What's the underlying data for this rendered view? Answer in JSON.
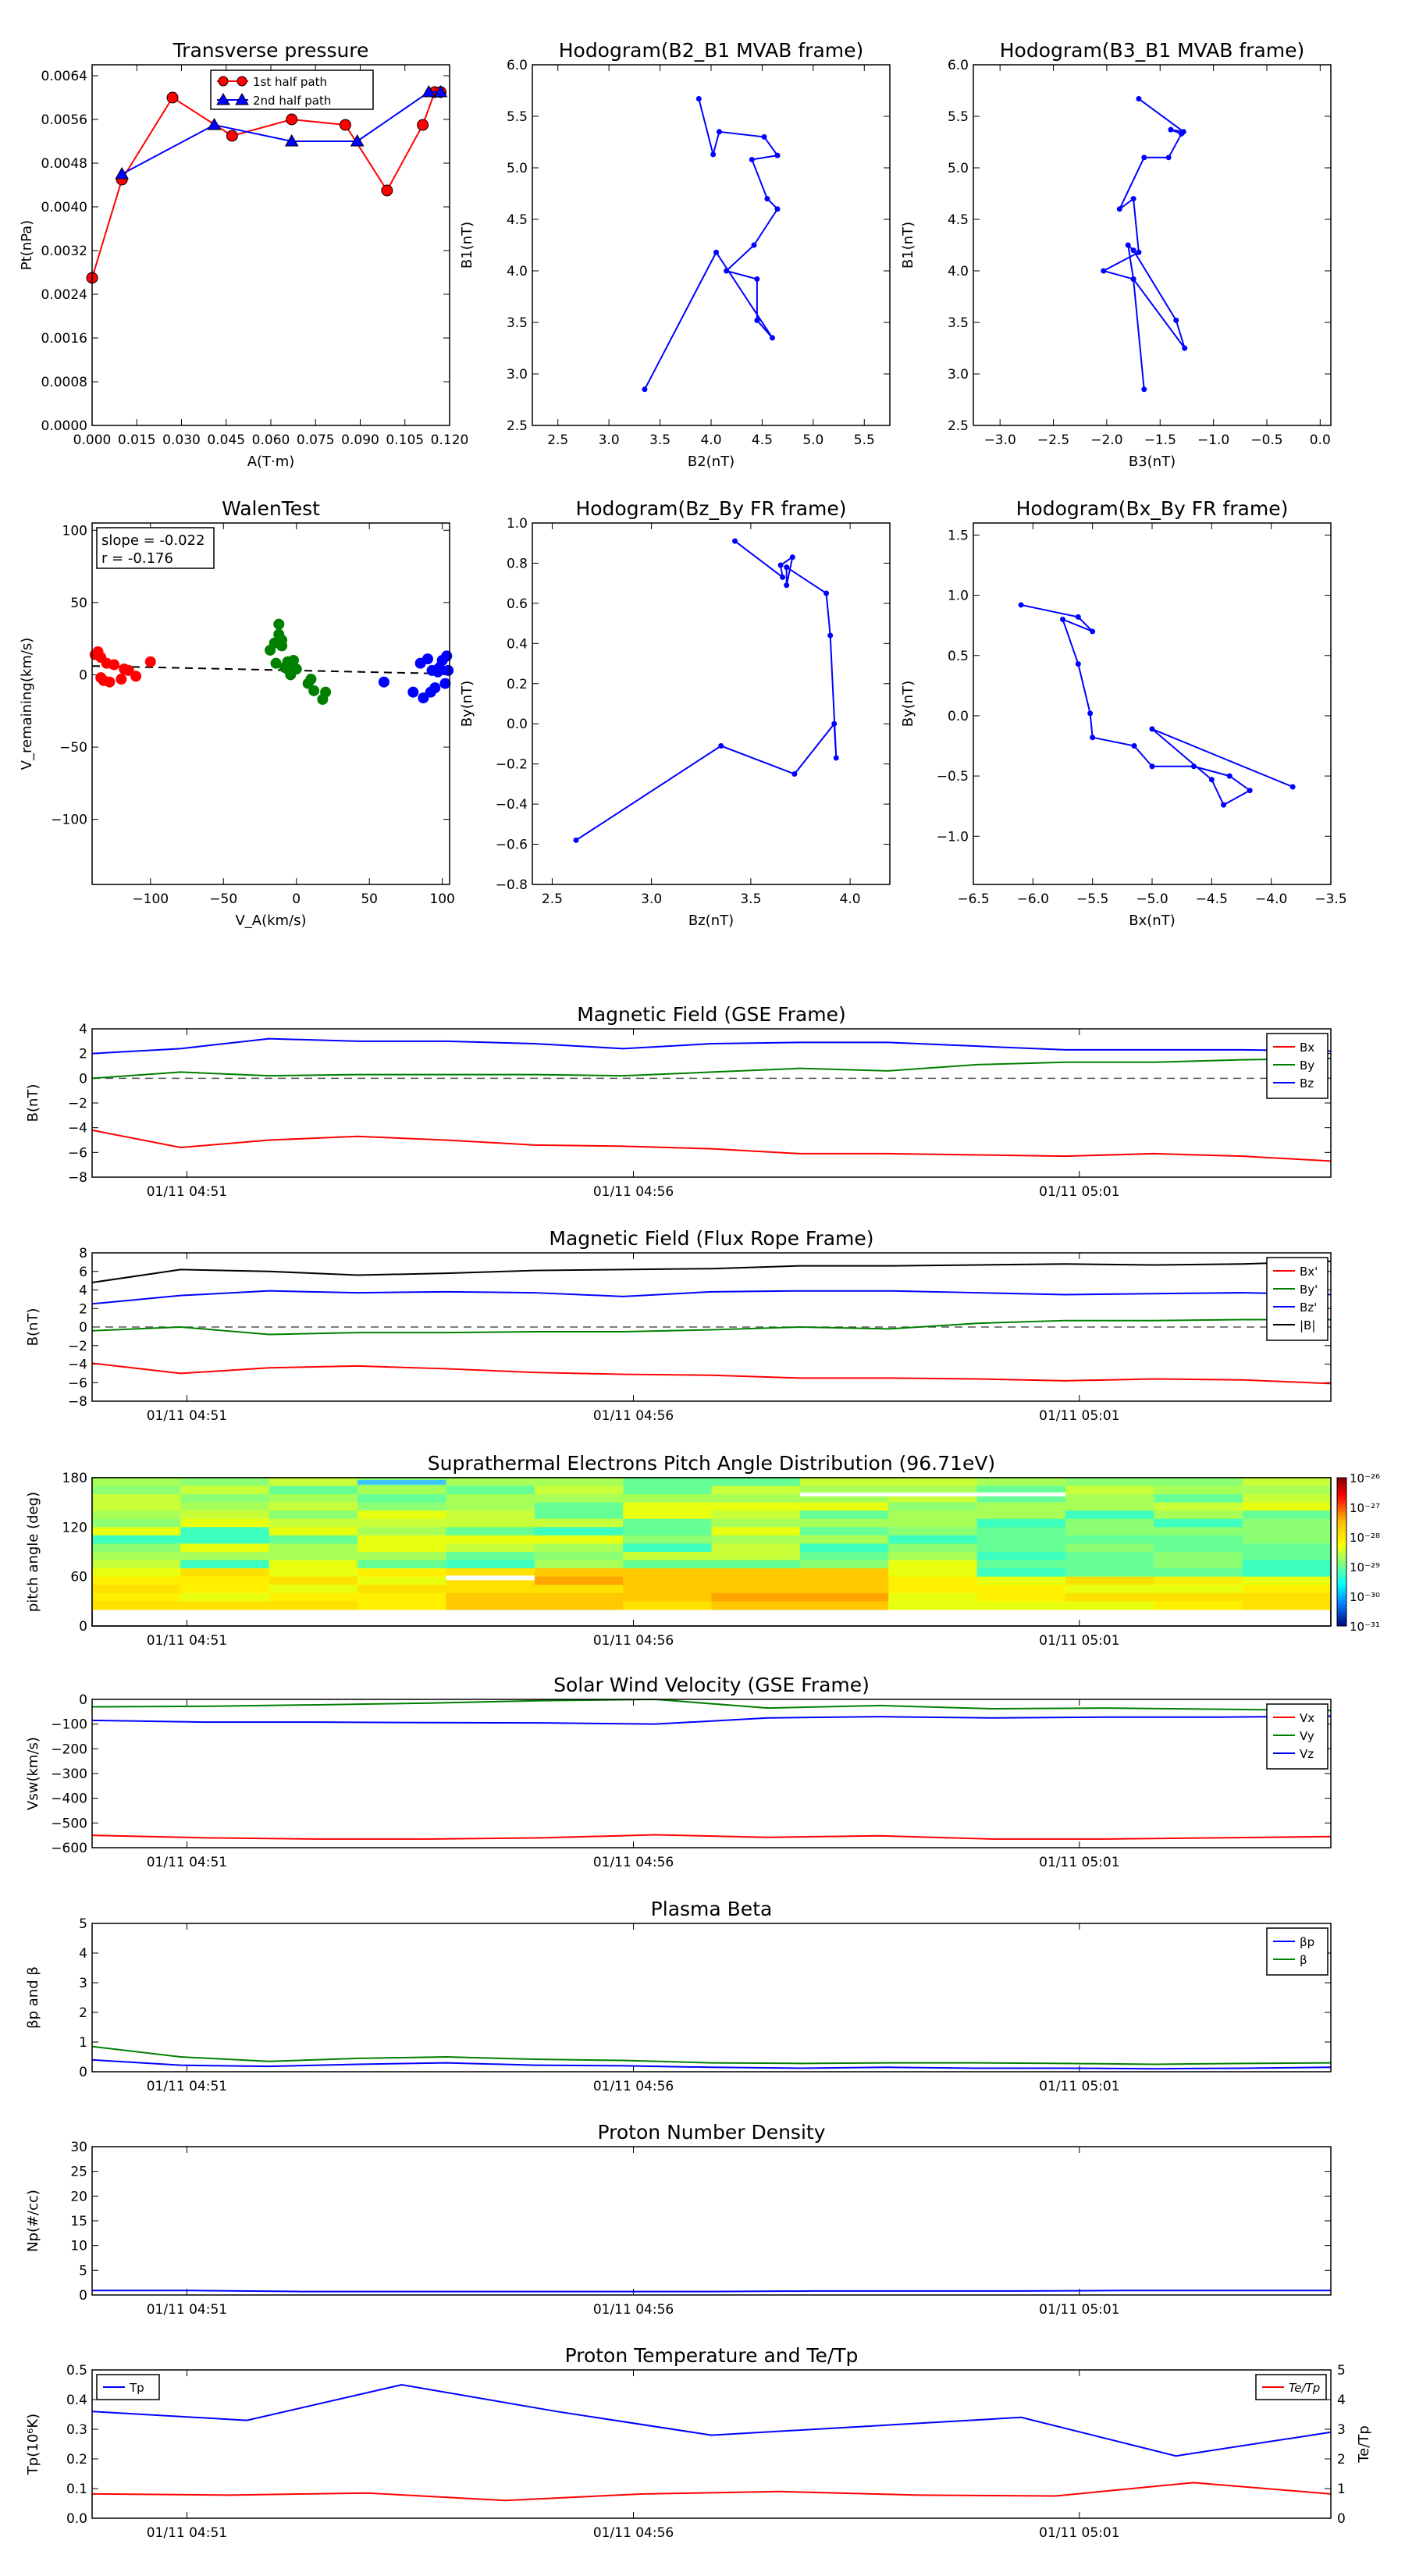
{
  "colors": {
    "red": "#ff0000",
    "green": "#008000",
    "blue": "#0000ff",
    "black": "#000000",
    "grey": "#555555"
  },
  "chart_data": [
    {
      "id": "transverse_pressure",
      "type": "line",
      "title": "Transverse pressure",
      "xlabel": "A(T·m)",
      "ylabel": "Pt(nPa)",
      "xlim": [
        0,
        0.12
      ],
      "ylim": [
        0,
        0.0066
      ],
      "xticks": [
        "0.000",
        "0.015",
        "0.030",
        "0.045",
        "0.060",
        "0.075",
        "0.090",
        "0.105",
        "0.120"
      ],
      "yticks": [
        "0.0000",
        "0.0008",
        "0.0016",
        "0.0024",
        "0.0032",
        "0.0040",
        "0.0048",
        "0.0056",
        "0.0064"
      ],
      "legend_position": "top-center",
      "series": [
        {
          "name": "1st half path",
          "color": "#ff0000",
          "marker": "circle",
          "x": [
            0.0,
            0.01,
            0.027,
            0.047,
            0.067,
            0.085,
            0.099,
            0.111,
            0.115,
            0.117
          ],
          "y": [
            0.0027,
            0.0045,
            0.006,
            0.0053,
            0.0056,
            0.0055,
            0.0043,
            0.0055,
            0.0061,
            0.0061
          ]
        },
        {
          "name": "2nd half path",
          "color": "#0000ff",
          "marker": "triangle",
          "x": [
            0.01,
            0.041,
            0.067,
            0.089,
            0.113,
            0.117
          ],
          "y": [
            0.0046,
            0.0055,
            0.0052,
            0.0052,
            0.0061,
            0.0061
          ]
        }
      ]
    },
    {
      "id": "hodogram_b2_b1",
      "type": "line",
      "title": "Hodogram(B2_B1 MVAB frame)",
      "xlabel": "B2(nT)",
      "ylabel": "B1(nT)",
      "xlim": [
        2.25,
        5.75
      ],
      "ylim": [
        2.5,
        6.0
      ],
      "xticks": [
        "2.5",
        "3.0",
        "3.5",
        "4.0",
        "4.5",
        "5.0",
        "5.5"
      ],
      "yticks": [
        "2.5",
        "3.0",
        "3.5",
        "4.0",
        "4.5",
        "5.0",
        "5.5",
        "6.0"
      ],
      "series": [
        {
          "color": "#0000ff",
          "marker": "dot",
          "x": [
            3.35,
            4.05,
            4.6,
            4.45,
            4.45,
            4.15,
            4.42,
            4.65,
            4.55,
            4.4,
            4.65,
            4.52,
            4.08,
            4.02,
            3.88
          ],
          "y": [
            2.85,
            4.18,
            3.35,
            3.52,
            3.92,
            4.0,
            4.25,
            4.6,
            4.7,
            5.08,
            5.12,
            5.3,
            5.35,
            5.13,
            5.67
          ]
        }
      ]
    },
    {
      "id": "hodogram_b3_b1",
      "type": "line",
      "title": "Hodogram(B3_B1 MVAB frame)",
      "xlabel": "B3(nT)",
      "ylabel": "B1(nT)",
      "xlim": [
        -3.25,
        0.1
      ],
      "ylim": [
        2.5,
        6.0
      ],
      "xticks": [
        "−3.0",
        "−2.5",
        "−2.0",
        "−1.5",
        "−1.0",
        "−0.5",
        "0.0"
      ],
      "yticks": [
        "2.5",
        "3.0",
        "3.5",
        "4.0",
        "4.5",
        "5.0",
        "5.5",
        "6.0"
      ],
      "series": [
        {
          "color": "#0000ff",
          "marker": "dot",
          "x": [
            -1.65,
            -1.75,
            -1.27,
            -1.35,
            -1.75,
            -1.8,
            -1.75,
            -2.03,
            -1.7,
            -1.75,
            -1.88,
            -1.65,
            -1.42,
            -1.3,
            -1.4,
            -1.28,
            -1.7
          ],
          "y": [
            2.85,
            3.92,
            3.25,
            3.52,
            4.2,
            4.25,
            3.92,
            4.0,
            4.18,
            4.7,
            4.6,
            5.1,
            5.1,
            5.33,
            5.37,
            5.35,
            5.67
          ]
        }
      ]
    },
    {
      "id": "walen_test",
      "type": "scatter",
      "title": "WalenTest",
      "xlabel": "V_A(km/s)",
      "ylabel": "V_remaining(km/s)",
      "xlim": [
        -140,
        105
      ],
      "ylim": [
        -145,
        105
      ],
      "xticks": [
        "−100",
        "−50",
        "0",
        "50",
        "100"
      ],
      "xtick_values": [
        -100,
        -50,
        0,
        50,
        100
      ],
      "yticks": [
        "−100",
        "−50",
        "0",
        "50",
        "100"
      ],
      "ytick_values": [
        -100,
        -50,
        0,
        50,
        100
      ],
      "annotation": {
        "slope": "slope = -0.022",
        "r": "r = -0.176"
      },
      "fit_line": {
        "slope": -0.022,
        "x": [
          -140,
          105
        ]
      },
      "series": [
        {
          "color": "#ff0000",
          "x": [
            -138,
            -136,
            -134,
            -134,
            -132,
            -130,
            -128,
            -125,
            -120,
            -118,
            -115,
            -110,
            -100
          ],
          "y": [
            14,
            16,
            12,
            -2,
            -4,
            8,
            -5,
            7,
            -3,
            4,
            3,
            -1,
            9
          ]
        },
        {
          "color": "#008000",
          "x": [
            -18,
            -15,
            -14,
            -12,
            -12,
            -10,
            -10,
            -8,
            -6,
            -5,
            -4,
            -2,
            0,
            8,
            10,
            12,
            18,
            20
          ],
          "y": [
            17,
            22,
            8,
            28,
            35,
            24,
            20,
            5,
            9,
            3,
            0,
            10,
            4,
            -6,
            -3,
            -11,
            -17,
            -12
          ]
        },
        {
          "color": "#0000ff",
          "x": [
            60,
            80,
            85,
            87,
            90,
            92,
            93,
            95,
            97,
            98,
            100,
            102,
            103,
            104
          ],
          "y": [
            -5,
            -12,
            8,
            -16,
            11,
            -12,
            3,
            -9,
            2,
            5,
            10,
            -6,
            13,
            3
          ]
        }
      ]
    },
    {
      "id": "hodogram_bz_by",
      "type": "line",
      "title": "Hodogram(Bz_By FR frame)",
      "xlabel": "Bz(nT)",
      "ylabel": "By(nT)",
      "xlim": [
        2.4,
        4.2
      ],
      "ylim": [
        -0.8,
        1.0
      ],
      "xticks": [
        "2.5",
        "3.0",
        "3.5",
        "4.0"
      ],
      "xtick_values": [
        2.5,
        3.0,
        3.5,
        4.0
      ],
      "yticks": [
        "−0.8",
        "−0.6",
        "−0.4",
        "−0.2",
        "0.0",
        "0.2",
        "0.4",
        "0.6",
        "0.8",
        "1.0"
      ],
      "series": [
        {
          "color": "#0000ff",
          "marker": "dot",
          "x": [
            2.62,
            3.35,
            3.72,
            3.92,
            3.93,
            3.9,
            3.88,
            3.68,
            3.68,
            3.71,
            3.65,
            3.66,
            3.42
          ],
          "y": [
            -0.58,
            -0.11,
            -0.25,
            0.0,
            -0.17,
            0.44,
            0.65,
            0.78,
            0.69,
            0.83,
            0.79,
            0.73,
            0.91
          ]
        }
      ]
    },
    {
      "id": "hodogram_bx_by",
      "type": "line",
      "title": "Hodogram(Bx_By FR frame)",
      "xlabel": "Bx(nT)",
      "ylabel": "By(nT)",
      "xlim": [
        -6.5,
        -3.5
      ],
      "ylim": [
        -1.4,
        1.6
      ],
      "xticks": [
        "−6.5",
        "−6.0",
        "−5.5",
        "−5.0",
        "−4.5",
        "−4.0",
        "−3.5"
      ],
      "yticks": [
        "−1.0",
        "−0.5",
        "0.0",
        "0.5",
        "1.0",
        "1.5"
      ],
      "ytick_values": [
        -1.0,
        -0.5,
        0.0,
        0.5,
        1.0,
        1.5
      ],
      "series": [
        {
          "color": "#0000ff",
          "marker": "dot",
          "x": [
            -6.1,
            -5.62,
            -5.5,
            -5.75,
            -5.62,
            -5.52,
            -5.5,
            -5.15,
            -5.0,
            -4.65,
            -4.35,
            -4.18,
            -4.4,
            -4.5,
            -5.0,
            -3.82
          ],
          "y": [
            0.92,
            0.82,
            0.7,
            0.8,
            0.43,
            0.02,
            -0.18,
            -0.25,
            -0.42,
            -0.42,
            -0.5,
            -0.62,
            -0.74,
            -0.53,
            -0.11,
            -0.59
          ]
        }
      ]
    },
    {
      "id": "mag_gse",
      "type": "line",
      "title": "Magnetic Field (GSE Frame)",
      "ylabel": "B(nT)",
      "ylim": [
        -8,
        4
      ],
      "yticks": [
        "−8",
        "−6",
        "−4",
        "−2",
        "0",
        "2",
        "4"
      ],
      "xticklabels": [
        "01/11 04:51",
        "01/11 04:56",
        "01/11 05:01"
      ],
      "legend_position": "top-right",
      "zero_line": true,
      "series": [
        {
          "name": "Bx",
          "color": "#ff0000",
          "y": [
            -4.2,
            -5.6,
            -5.0,
            -4.7,
            -5.0,
            -5.4,
            -5.5,
            -5.7,
            -6.1,
            -6.1,
            -6.2,
            -6.3,
            -6.1,
            -6.3,
            -6.7
          ]
        },
        {
          "name": "By",
          "color": "#008000",
          "y": [
            0.0,
            0.5,
            0.2,
            0.3,
            0.3,
            0.3,
            0.2,
            0.5,
            0.8,
            0.6,
            1.1,
            1.3,
            1.3,
            1.5,
            1.6
          ]
        },
        {
          "name": "Bz",
          "color": "#0000ff",
          "y": [
            2.0,
            2.4,
            3.2,
            3.0,
            3.0,
            2.8,
            2.4,
            2.8,
            2.9,
            2.9,
            2.6,
            2.3,
            2.3,
            2.3,
            2.2
          ]
        }
      ]
    },
    {
      "id": "mag_fr",
      "type": "line",
      "title": "Magnetic Field (Flux Rope Frame)",
      "ylabel": "B(nT)",
      "ylim": [
        -8,
        8
      ],
      "yticks": [
        "−8",
        "−6",
        "−4",
        "−2",
        "0",
        "2",
        "4",
        "6",
        "8"
      ],
      "xticklabels": [
        "01/11 04:51",
        "01/11 04:56",
        "01/11 05:01"
      ],
      "legend_position": "top-right",
      "zero_line": true,
      "series": [
        {
          "name": "Bx'",
          "color": "#ff0000",
          "y": [
            -3.9,
            -5.0,
            -4.4,
            -4.2,
            -4.5,
            -4.9,
            -5.1,
            -5.2,
            -5.5,
            -5.5,
            -5.6,
            -5.8,
            -5.6,
            -5.7,
            -6.1
          ]
        },
        {
          "name": "By'",
          "color": "#008000",
          "y": [
            -0.4,
            0.0,
            -0.8,
            -0.6,
            -0.6,
            -0.5,
            -0.5,
            -0.3,
            0.0,
            -0.2,
            0.4,
            0.7,
            0.7,
            0.8,
            0.8
          ]
        },
        {
          "name": "Bz'",
          "color": "#0000ff",
          "y": [
            2.5,
            3.4,
            3.9,
            3.7,
            3.8,
            3.7,
            3.3,
            3.8,
            3.9,
            3.9,
            3.7,
            3.5,
            3.6,
            3.7,
            3.5
          ]
        },
        {
          "name": "|B|",
          "color": "#000000",
          "y": [
            4.8,
            6.2,
            6.0,
            5.6,
            5.8,
            6.1,
            6.2,
            6.3,
            6.6,
            6.6,
            6.7,
            6.8,
            6.7,
            6.8,
            7.1
          ]
        }
      ]
    },
    {
      "id": "pitch_angle",
      "type": "heatmap",
      "title": "Suprathermal Electrons Pitch Angle Distribution (96.71eV)",
      "ylabel": "pitch angle (deg)",
      "ylim": [
        0,
        180
      ],
      "yticks": [
        "0",
        "60",
        "120",
        "180"
      ],
      "xticklabels": [
        "01/11 04:51",
        "01/11 04:56",
        "01/11 05:01"
      ],
      "colorbar_labels": [
        "10⁻²⁶",
        "10⁻²⁷",
        "10⁻²⁸",
        "10⁻²⁹",
        "10⁻³⁰",
        "10⁻³¹"
      ]
    },
    {
      "id": "vsw",
      "type": "line",
      "title": "Solar Wind Velocity (GSE Frame)",
      "ylabel": "Vsw(km/s)",
      "ylim": [
        -600,
        0
      ],
      "yticks": [
        "−600",
        "−500",
        "−400",
        "−300",
        "−200",
        "−100",
        "0"
      ],
      "xticklabels": [
        "01/11 04:51",
        "01/11 04:56",
        "01/11 05:01"
      ],
      "legend_position": "top-right",
      "series": [
        {
          "name": "Vx",
          "color": "#ff0000",
          "y": [
            -550,
            -560,
            -565,
            -565,
            -560,
            -548,
            -558,
            -552,
            -565,
            -565,
            -560,
            -555
          ]
        },
        {
          "name": "Vy",
          "color": "#008000",
          "y": [
            -30,
            -28,
            -22,
            -15,
            -5,
            0,
            -35,
            -25,
            -38,
            -35,
            -40,
            -45
          ]
        },
        {
          "name": "Vz",
          "color": "#0000ff",
          "y": [
            -85,
            -92,
            -92,
            -94,
            -95,
            -100,
            -75,
            -70,
            -75,
            -72,
            -72,
            -68
          ]
        }
      ]
    },
    {
      "id": "beta",
      "type": "line",
      "title": "Plasma Beta",
      "ylabel": "βp and β",
      "ylim": [
        0,
        5
      ],
      "yticks": [
        "0",
        "1",
        "2",
        "3",
        "4",
        "5"
      ],
      "xticklabels": [
        "01/11 04:51",
        "01/11 04:56",
        "01/11 05:01"
      ],
      "legend_position": "top-right",
      "series": [
        {
          "name": "βp",
          "color": "#0000ff",
          "y": [
            0.4,
            0.22,
            0.18,
            0.25,
            0.3,
            0.22,
            0.2,
            0.15,
            0.12,
            0.15,
            0.12,
            0.12,
            0.1,
            0.12,
            0.15
          ]
        },
        {
          "name": "β",
          "color": "#008000",
          "y": [
            0.85,
            0.5,
            0.35,
            0.45,
            0.5,
            0.42,
            0.38,
            0.3,
            0.28,
            0.3,
            0.3,
            0.28,
            0.25,
            0.28,
            0.3
          ]
        }
      ]
    },
    {
      "id": "density",
      "type": "line",
      "title": "Proton Number Density",
      "ylabel": "Np(#/cc)",
      "ylim": [
        0,
        30
      ],
      "yticks": [
        "0",
        "5",
        "10",
        "15",
        "20",
        "25",
        "30"
      ],
      "xticklabels": [
        "01/11 04:51",
        "01/11 04:56",
        "01/11 05:01"
      ],
      "series": [
        {
          "color": "#0000ff",
          "y": [
            0.9,
            0.9,
            0.7,
            0.7,
            0.7,
            0.7,
            0.7,
            0.8,
            0.8,
            0.8,
            0.9,
            0.9,
            0.9
          ]
        }
      ]
    },
    {
      "id": "temperature",
      "type": "line",
      "title": "Proton Temperature and Te/Tp",
      "ylabel": "Tp(10⁶K)",
      "ylabel_right": "Te/Tp",
      "ylim": [
        0,
        0.5
      ],
      "yticks": [
        "0.0",
        "0.1",
        "0.2",
        "0.3",
        "0.4",
        "0.5"
      ],
      "ylim_right": [
        0,
        5
      ],
      "yticks_right": [
        "0",
        "1",
        "2",
        "3",
        "4",
        "5"
      ],
      "xticklabels": [
        "01/11 04:51",
        "01/11 04:56",
        "01/11 05:01"
      ],
      "legend_left": "Tp",
      "legend_right": "Te/Tp",
      "series": [
        {
          "name": "Tp",
          "color": "#0000ff",
          "axis": "left",
          "y": [
            0.36,
            0.33,
            0.45,
            0.36,
            0.28,
            0.31,
            0.34,
            0.21,
            0.29
          ]
        },
        {
          "name": "Te/Tp",
          "color": "#ff0000",
          "axis": "right",
          "y": [
            0.82,
            0.78,
            0.85,
            0.6,
            0.82,
            0.9,
            0.78,
            0.75,
            1.2,
            0.82
          ]
        }
      ]
    }
  ]
}
